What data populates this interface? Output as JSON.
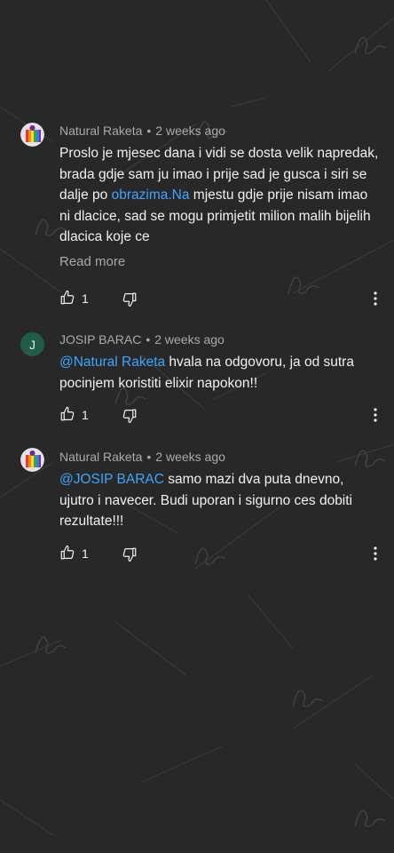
{
  "comments": [
    {
      "author": "Natural Raketa",
      "separator": "•",
      "time": "2 weeks ago",
      "text_before_link": "Proslo je mjesec dana i vidi se dosta velik napredak, brada gdje sam ju imao i prije sad je gusca i siri se dalje po ",
      "link_text": "obrazima.Na",
      "text_after_link": " mjestu gdje prije nisam imao ni dlacice, sad se mogu primjetit milion malih bijelih dlacica koje ce",
      "read_more": "Read more",
      "likes": "1",
      "avatar_icon": "rainbow-fist-icon"
    },
    {
      "author": "JOSIP BARAC",
      "separator": "•",
      "time": "2 weeks ago",
      "mention": "@Natural Raketa",
      "text": " hvala na odgovoru, ja od sutra pocinjem koristiti elixir napokon!!",
      "likes": "1",
      "avatar_letter": "J"
    },
    {
      "author": "Natural Raketa",
      "separator": "•",
      "time": "2 weeks ago",
      "mention": "@JOSIP BARAC",
      "text": " samo mazi dva puta dnevno, ujutro i navecer. Budi uporan i sigurno ces dobiti rezultate!!!",
      "likes": "1",
      "avatar_icon": "rainbow-fist-icon"
    }
  ],
  "colors": {
    "background": "#282828",
    "link": "#3ea6ff",
    "meta": "#aaaaaa",
    "text": "#f1f1f1",
    "avatar_j": "#1f5c4a"
  },
  "icons": [
    "like-icon",
    "dislike-icon",
    "more-vert-icon",
    "signature-watermark"
  ]
}
